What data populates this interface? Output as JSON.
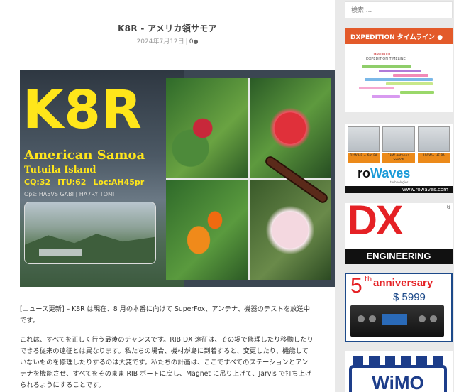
{
  "post": {
    "title": "K8R - アメリカ領サモア",
    "date": "2024年7月12日",
    "separator": "|",
    "comments": "0"
  },
  "hero": {
    "callsign": "K8R",
    "place": "American Samoa",
    "island": "Tutuila Island",
    "cq": "CQ:32",
    "itu": "ITU:62",
    "loc": "Loc:AH45pr",
    "ops": "Ops: HA5VS GABI | HA7RY TOMI"
  },
  "article": {
    "p1": "[ニュース更新] – K8R は現在、8 月の本番に向けて SuperFox、アンテナ、機器のテストを放送中です。",
    "p2": "これは、すべてを正しく行う最後のチャンスです。RIB DX 遠征は、その場で修理したり移動したりできる従来の遠征とは異なります。私たちの場合、機材が島に到着すると、変更したり、機能していないものを修理したりするのは大変です。私たちの計画は、ここですべてのステーションとアンテナを機能させ、すべてをそのまま RIB ボートに戻し、Magnet に吊り上げて、Jarvis で打ち上げられるようにすることです。"
  },
  "sidebar": {
    "search_placeholder": "検索 …",
    "timeline_title": "DXPEDITION タイムライン",
    "timeline_logo": "DXWORLD",
    "timeline_sub": "DXPEDITION TIMELINE",
    "rowaves_products": [
      "1kW HF + 6m PA",
      "1kW Antenna Switch",
      "100W+ HF PA"
    ],
    "rowaves_brand_a": "ro",
    "rowaves_brand_b": "Waves",
    "rowaves_tag": "technologies",
    "rowaves_url": "www.rowaves.com",
    "dx_letters": "DX",
    "dx_sub": "ENGINEERING",
    "dx_reg": "®",
    "anniv_num": "5",
    "anniv_th": "th",
    "anniv_text": "anniversary",
    "anniv_price": "$ 5999",
    "wimo": "WiMO"
  },
  "colors": {
    "accent": "#e35a2a",
    "hero_text": "#ffe61a",
    "dx_red": "#e52125"
  }
}
